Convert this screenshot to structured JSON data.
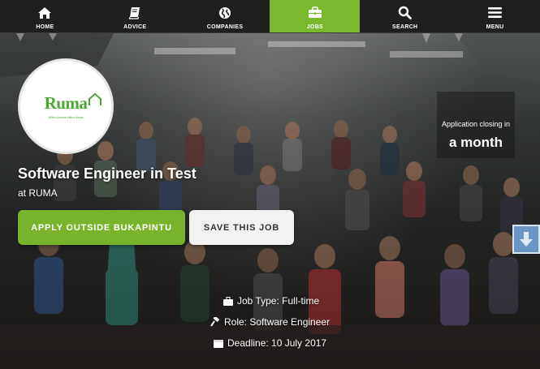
{
  "nav": {
    "items": [
      {
        "label": "HOME",
        "icon": "home-icon"
      },
      {
        "label": "ADVICE",
        "icon": "book-icon"
      },
      {
        "label": "COMPANIES",
        "icon": "globe-icon"
      },
      {
        "label": "JOBS",
        "icon": "briefcase-icon",
        "active": true
      },
      {
        "label": "SEARCH",
        "icon": "search-icon"
      },
      {
        "label": "MENU",
        "icon": "hamburger-icon"
      }
    ],
    "active_color": "#7bb830"
  },
  "logo": {
    "wordmark": "Ruma",
    "tagline": "Mitra Usaha Mikro Anda"
  },
  "job": {
    "title": "Software Engineer in Test",
    "company": "at RUMA",
    "apply_label": "APPLY OUTSIDE BUKAPINTU",
    "save_label": "SAVE THIS JOB"
  },
  "closing": {
    "label": "Application closing in",
    "value": "a month"
  },
  "details": {
    "job_type": "Job Type: Full-time",
    "role": "Role: Software Engineer",
    "deadline": "Deadline: 10 July 2017"
  },
  "colors": {
    "accent": "#79b22b",
    "brand_green": "#4aa935"
  }
}
